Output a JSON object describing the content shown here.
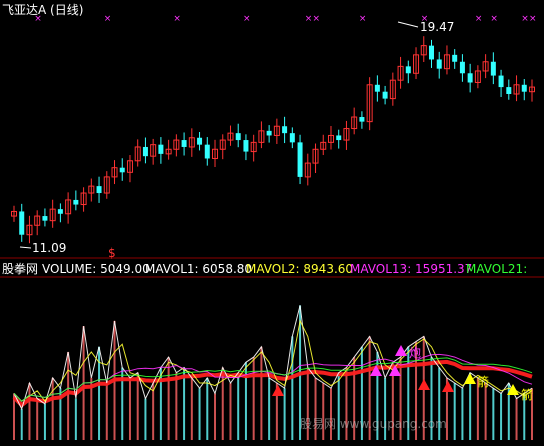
{
  "title": "飞亚达A (日线)",
  "price_high_label": "19.47",
  "price_low_label": "11.09",
  "dollar_marker": "$",
  "indicator_header": {
    "source": "股拳网",
    "items": [
      {
        "text": "VOLUME: 5049.00",
        "color": "#ffffff"
      },
      {
        "text": "MAVOL1: 6058.80",
        "color": "#ffffff"
      },
      {
        "text": "MAVOL2: 8943.60",
        "color": "#ffff33"
      },
      {
        "text": "MAVOL13: 15951.37",
        "color": "#ff33ff"
      },
      {
        "text": "MAVOL21:",
        "color": "#33ff33"
      }
    ]
  },
  "signal_labels": {
    "pao": "炮",
    "jian": "箭"
  },
  "watermark": "股易网 www.gupang.com",
  "colors": {
    "up": "#ff3333",
    "down": "#33ffff",
    "purple_marker": "#ff33ff",
    "band": "#ff2020",
    "yellow": "#ffff00"
  },
  "chart_data": {
    "type": "candlestick",
    "price_range": [
      10.6,
      20.5
    ],
    "closes": [
      12.1,
      11.09,
      11.5,
      11.9,
      11.7,
      12.2,
      12.0,
      12.6,
      12.4,
      12.9,
      13.2,
      12.9,
      13.6,
      14.0,
      13.8,
      14.3,
      14.9,
      14.5,
      15.0,
      14.6,
      14.8,
      15.2,
      14.9,
      15.3,
      15.0,
      14.4,
      14.8,
      15.2,
      15.5,
      15.2,
      14.7,
      15.1,
      15.6,
      15.4,
      15.8,
      15.5,
      15.1,
      13.6,
      14.2,
      14.8,
      15.1,
      15.4,
      15.2,
      15.7,
      16.2,
      16.0,
      17.6,
      17.3,
      17.0,
      17.8,
      18.4,
      18.1,
      18.9,
      19.3,
      18.7,
      18.3,
      18.9,
      18.6,
      18.1,
      17.7,
      18.2,
      18.6,
      18.0,
      17.5,
      17.2,
      17.6,
      17.3,
      17.5
    ],
    "volume": [
      45,
      30,
      55,
      40,
      35,
      60,
      50,
      85,
      40,
      110,
      60,
      90,
      55,
      115,
      70,
      60,
      65,
      40,
      55,
      70,
      80,
      65,
      70,
      60,
      50,
      60,
      45,
      70,
      55,
      65,
      75,
      80,
      90,
      60,
      55,
      50,
      100,
      130,
      70,
      60,
      55,
      50,
      65,
      70,
      80,
      90,
      100,
      85,
      60,
      75,
      80,
      90,
      95,
      100,
      80,
      70,
      60,
      55,
      50,
      65,
      60,
      55,
      50,
      45,
      55,
      40,
      45,
      50
    ],
    "mavol_lines": [
      {
        "name": "MAVOL1",
        "color": "#ffffff"
      },
      {
        "name": "MAVOL2",
        "color": "#ffff33"
      },
      {
        "name": "MAVOL13",
        "color": "#ff33ff"
      },
      {
        "name": "MAVOL21",
        "color": "#33ff33"
      }
    ]
  }
}
